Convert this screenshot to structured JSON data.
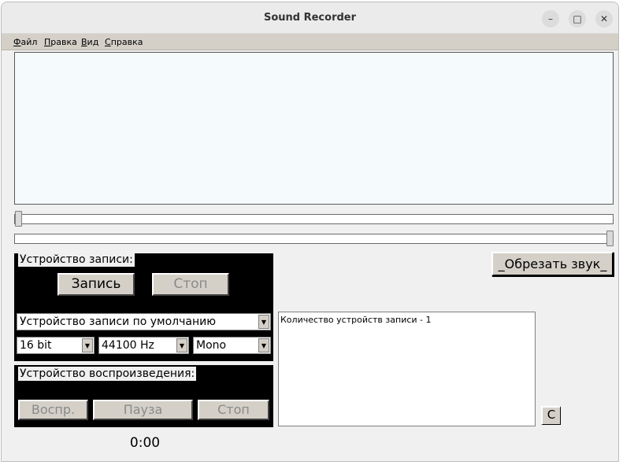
{
  "window": {
    "title": "Sound Recorder",
    "minimize_glyph": "–",
    "maximize_glyph": "□",
    "close_glyph": "✕"
  },
  "menu": {
    "items": [
      "Файл",
      "Правка",
      "Вид",
      "Справка"
    ]
  },
  "trim_button": "_Обрезать звук_",
  "recording": {
    "group_label": "Устройство записи:",
    "record_button": "Запись",
    "stop_button": "Стоп",
    "device": "Устройство записи по умолчанию",
    "bit_depth": "16 bit",
    "sample_rate": "44100 Hz",
    "channels": "Mono"
  },
  "playback": {
    "group_label": "Устройство воспроизведения:",
    "play_button": "Воспр.",
    "pause_button": "Пауза",
    "stop_button": "Стоп"
  },
  "log_text": "Количество устройств записи - 1",
  "clear_button": "C",
  "time": "0:00",
  "colors": {
    "panel": "#000000",
    "waveform_bg": "#f5fbfd",
    "button_face": "#d4d0c8"
  }
}
